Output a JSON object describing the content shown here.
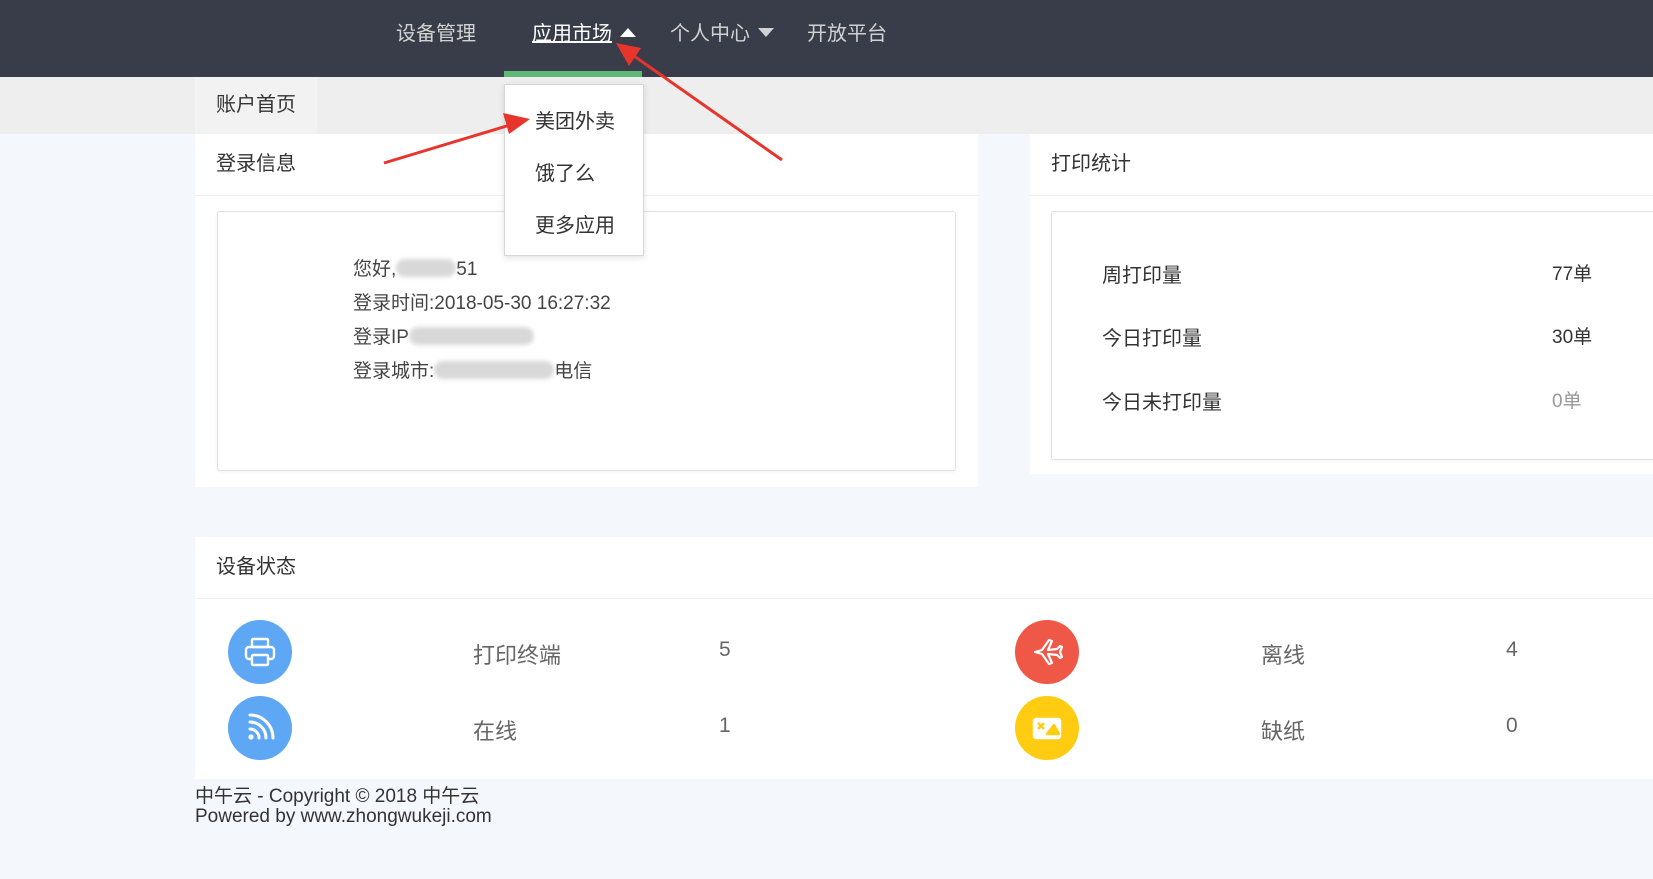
{
  "nav": {
    "items": [
      {
        "label": "设备管理"
      },
      {
        "label": "应用市场"
      },
      {
        "label": "个人中心"
      },
      {
        "label": "开放平台"
      }
    ]
  },
  "dropdown": {
    "items": [
      {
        "label": "美团外卖"
      },
      {
        "label": "饿了么"
      },
      {
        "label": "更多应用"
      }
    ]
  },
  "tabs": [
    {
      "label": "账户首页"
    }
  ],
  "login_card": {
    "title": "登录信息",
    "greeting_prefix": "您好,",
    "greeting_suffix": "51",
    "login_time": "登录时间:2018-05-30 16:27:32",
    "login_ip_prefix": "登录IP",
    "login_city_prefix": "登录城市:",
    "login_city_suffix": "电信"
  },
  "print_card": {
    "title": "打印统计",
    "rows": [
      {
        "label": "周打印量",
        "value": "77单"
      },
      {
        "label": "今日打印量",
        "value": "30单"
      },
      {
        "label": "今日未打印量",
        "value": "0单"
      }
    ]
  },
  "device_card": {
    "title": "设备状态",
    "items": [
      {
        "label": "打印终端",
        "value": "5",
        "icon": "printer-icon",
        "color": "#5ea7f5"
      },
      {
        "label": "离线",
        "value": "4",
        "icon": "airplane-icon",
        "color": "#ef5846"
      },
      {
        "label": "在线",
        "value": "1",
        "icon": "signal-icon",
        "color": "#5ea7f5"
      },
      {
        "label": "缺纸",
        "value": "0",
        "icon": "paper-missing-icon",
        "color": "#ffcc11"
      }
    ]
  },
  "footer": {
    "line1": "中午云 - Copyright © 2018 中午云",
    "line2": "Powered by www.zhongwukeji.com"
  },
  "colors": {
    "nav_bg": "#393d49",
    "accent_green": "#5fb878",
    "annotation_red": "#e8352c"
  }
}
